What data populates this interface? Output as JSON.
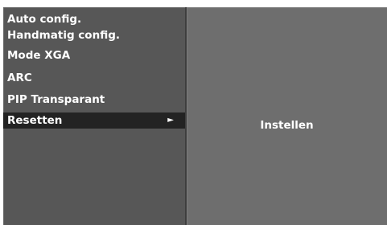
{
  "menu": {
    "items": [
      {
        "label": "Auto config.",
        "selected": false
      },
      {
        "label": "Handmatig config.",
        "selected": false
      },
      {
        "label": "Mode XGA",
        "selected": false
      },
      {
        "label": "ARC",
        "selected": false
      },
      {
        "label": "PIP Transparant",
        "selected": false
      },
      {
        "label": "Resetten",
        "selected": true,
        "arrow": "►"
      }
    ]
  },
  "submenu": {
    "label": "Instellen"
  },
  "colors": {
    "menu_background": "#575757",
    "submenu_background": "#6e6e6e",
    "highlight": "#232323",
    "text": "#ffffff"
  },
  "icons": {
    "submenu_arrow": "arrow-right-icon"
  }
}
